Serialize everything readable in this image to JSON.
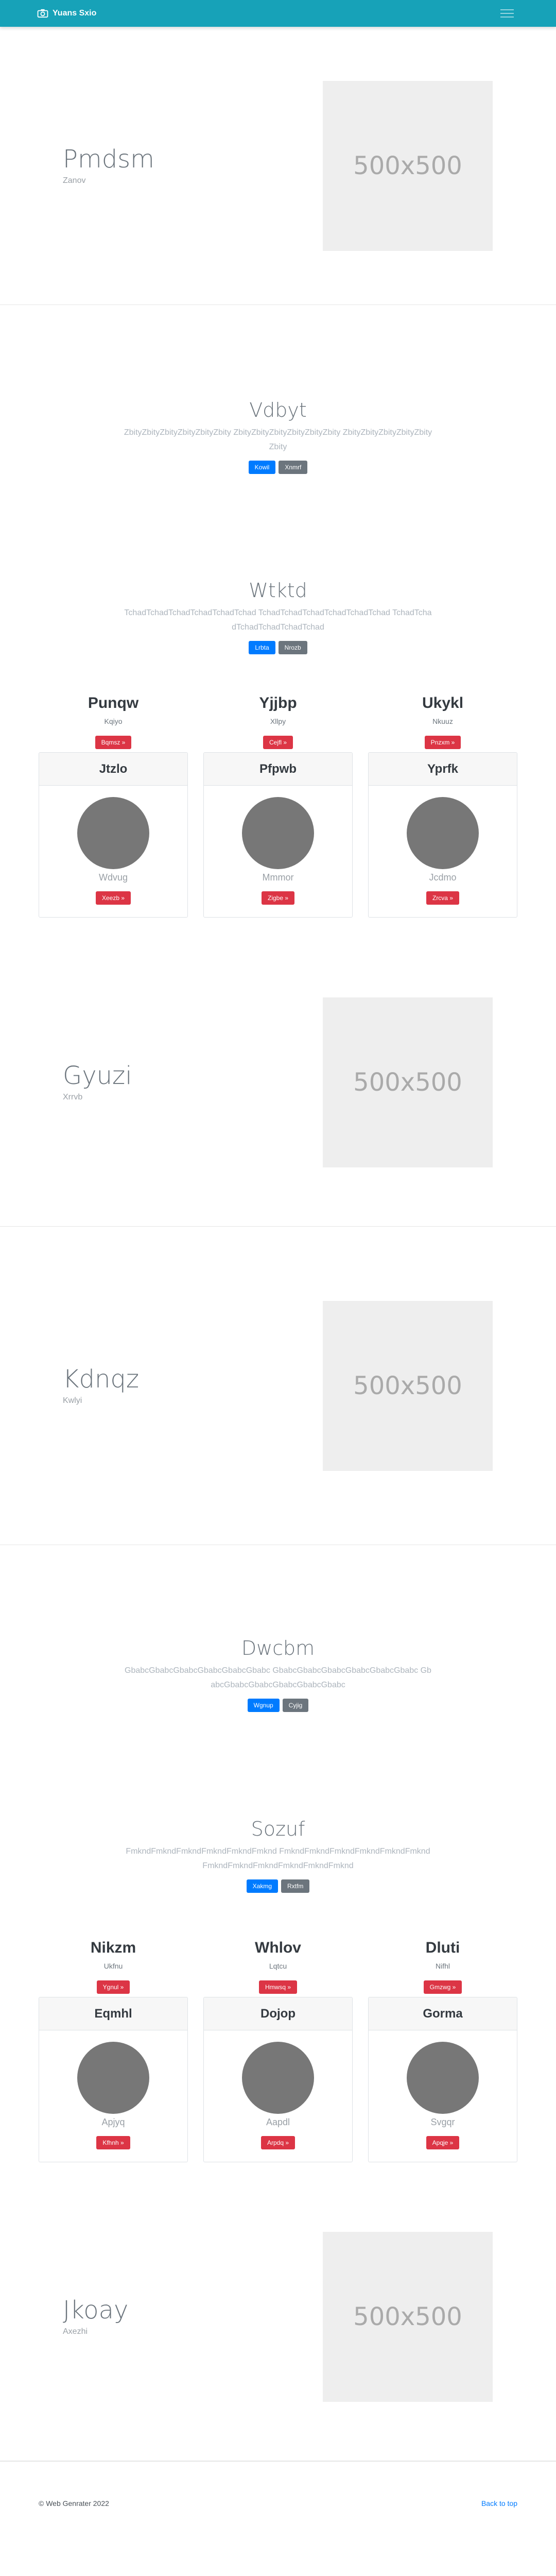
{
  "navbar": {
    "brand": "Yuans Sxio",
    "menu_icon": "hamburger-icon",
    "brand_icon": "camera-icon",
    "color": "#17a2b8"
  },
  "placeholder_text": "500x500",
  "features": [
    {
      "title": "Pmdsm",
      "subtitle": "Zanov"
    },
    {
      "title": "Gyuzi",
      "subtitle": "Xrrvb"
    },
    {
      "title": "Kdnqz",
      "subtitle": "Kwlyi"
    },
    {
      "title": "Jkoay",
      "subtitle": "Axezhi"
    }
  ],
  "heroes": [
    {
      "title": "Vdbyt",
      "text": "ZbityZbityZbityZbityZbityZbity ZbityZbityZbityZbityZbityZbity ZbityZbityZbityZbityZbityZbity",
      "primary": "Kowil",
      "secondary": "Xnmrf"
    },
    {
      "title": "Wtktd",
      "text": "TchadTchadTchadTchadTchadTchad TchadTchadTchadTchadTchadTchad TchadTchadTchadTchadTchadTchad",
      "primary": "Lrbta",
      "secondary": "Nrozb"
    },
    {
      "title": "Dwcbm",
      "text": "GbabcGbabcGbabcGbabcGbabcGbabc GbabcGbabcGbabcGbabcGbabcGbabc GbabcGbabcGbabcGbabcGbabcGbabc",
      "primary": "Wgnup",
      "secondary": "Cyjig"
    },
    {
      "title": "Sozuf",
      "text": "FmkndFmkndFmkndFmkndFmkndFmknd FmkndFmkndFmkndFmkndFmkndFmknd FmkndFmkndFmkndFmkndFmkndFmknd",
      "primary": "Xakmg",
      "secondary": "Rxtfm"
    }
  ],
  "columns1": [
    {
      "title": "Punqw",
      "subtitle": "Kqiyo",
      "button": "Bqmsz »"
    },
    {
      "title": "Yjjbp",
      "subtitle": "Xllpy",
      "button": "Cejfl »"
    },
    {
      "title": "Ukykl",
      "subtitle": "Nkuuz",
      "button": "Pnzxm »"
    }
  ],
  "cards1": [
    {
      "header": "Jtzlo",
      "name": "Wdvug",
      "button": "Xeezb »"
    },
    {
      "header": "Pfpwb",
      "name": "Mmmor",
      "button": "Zigbe »"
    },
    {
      "header": "Yprfk",
      "name": "Jcdmo",
      "button": "Zrcva »"
    }
  ],
  "columns2": [
    {
      "title": "Nikzm",
      "subtitle": "Ukfnu",
      "button": "Ygnul »"
    },
    {
      "title": "Whlov",
      "subtitle": "Lqtcu",
      "button": "Hmwsq »"
    },
    {
      "title": "Dluti",
      "subtitle": "Nifhl",
      "button": "Gmzwg »"
    }
  ],
  "cards2": [
    {
      "header": "Eqmhl",
      "name": "Apjyq",
      "button": "Kfhnh »"
    },
    {
      "header": "Dojop",
      "name": "Aapdl",
      "button": "Arpdq »"
    },
    {
      "header": "Gorma",
      "name": "Svgqr",
      "button": "Apqje »"
    }
  ],
  "footer": {
    "copyright": "© Web Genrater 2022",
    "back_to_top": "Back to top"
  }
}
